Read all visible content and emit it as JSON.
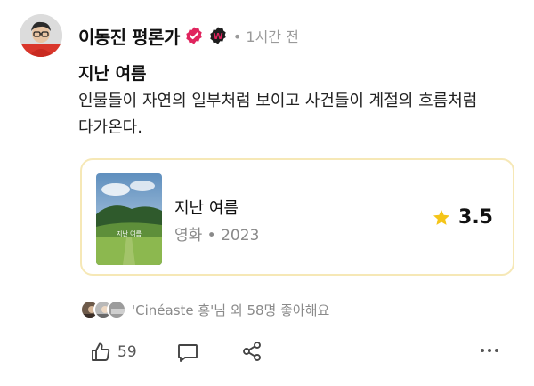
{
  "post": {
    "author": "이동진 평론가",
    "verified_icon": "verified-check-icon",
    "brand_badge_icon": "w-badge-icon",
    "meta": "• 1시간 전",
    "title": "지난 여름",
    "body": "인물들이 자연의 일부처럼 보이고 사건들이 계절의 흐름처럼 다가온다."
  },
  "card": {
    "title": "지난 여름",
    "subtitle": "영화 • 2023",
    "rating": "3.5",
    "poster_text": "지난 여름"
  },
  "likes": {
    "text": "'Cinéaste 홍'님 외 58명 좋아해요"
  },
  "actions": {
    "like_count": "59"
  },
  "colors": {
    "verified": "#e0245e",
    "star": "#f5c518",
    "card_border": "#f6e8b6"
  }
}
